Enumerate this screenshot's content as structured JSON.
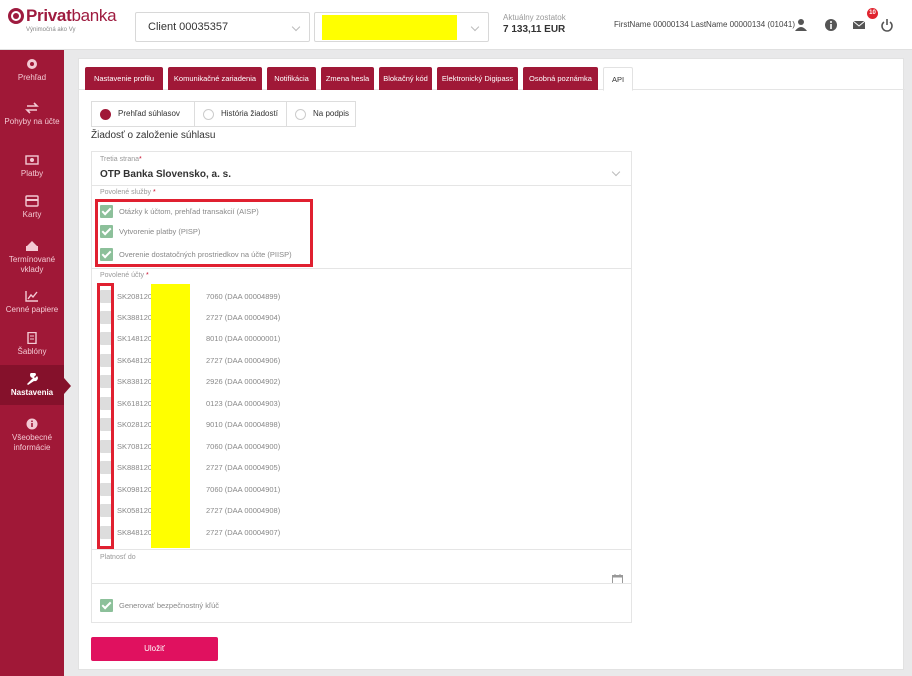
{
  "header": {
    "logo_main": "Privat",
    "logo_light": "banka",
    "logo_sub": "Výnimočná ako Vy",
    "client": "Client 00035357",
    "balance_label": "Aktuálny zostatok",
    "balance_value": "7 133,11 EUR",
    "user_name": "FirstName 00000134 LastName 00000134 (01041)",
    "mail_count": "10"
  },
  "sidebar": {
    "items": [
      {
        "label": "Prehľad",
        "icon": "dashboard-icon"
      },
      {
        "label": "Pohyby na účte",
        "icon": "transfers-icon"
      },
      {
        "label": "Platby",
        "icon": "payments-icon"
      },
      {
        "label": "Karty",
        "icon": "card-icon"
      },
      {
        "label": "Termínované vklady",
        "icon": "deposits-icon"
      },
      {
        "label": "Cenné papiere",
        "icon": "chart-icon"
      },
      {
        "label": "Šablóny",
        "icon": "document-icon"
      },
      {
        "label": "Nastavenia",
        "icon": "wrench-icon"
      },
      {
        "label": "Všeobecné informácie",
        "icon": "info-icon"
      }
    ]
  },
  "tabs": [
    "Nastavenie profilu",
    "Komunikačné zariadenia",
    "Notifikácia",
    "Zmena hesla",
    "Blokačný kód",
    "Elektronický Digipass",
    "Osobná poznámka",
    "API"
  ],
  "subtabs": [
    "Prehľad súhlasov",
    "História žiadostí",
    "Na podpis"
  ],
  "section_title": "Žiadosť o založenie súhlasu",
  "form": {
    "third_party_label": "Tretia strana",
    "third_party_value": "OTP Banka Slovensko, a. s.",
    "services_label": "Povolené služby",
    "services": [
      "Otázky k účtom, prehľad transakcií (AISP)",
      "Vytvorenie platby (PISP)",
      "Overenie dostatočných prostriedkov na účte (PIISP)"
    ],
    "accounts_label": "Povolené účty",
    "accounts": [
      {
        "prefix": "SK208120",
        "suffix": "7060 (DAA 00004899)"
      },
      {
        "prefix": "SK388120",
        "suffix": "2727 (DAA 00004904)"
      },
      {
        "prefix": "SK148120",
        "suffix": "8010 (DAA 00000001)"
      },
      {
        "prefix": "SK648120",
        "suffix": "2727 (DAA 00004906)"
      },
      {
        "prefix": "SK838120",
        "suffix": "2926 (DAA 00004902)"
      },
      {
        "prefix": "SK618120",
        "suffix": "0123 (DAA 00004903)"
      },
      {
        "prefix": "SK028120",
        "suffix": "9010 (DAA 00004898)"
      },
      {
        "prefix": "SK708120",
        "suffix": "7060 (DAA 00004900)"
      },
      {
        "prefix": "SK888120",
        "suffix": "2727 (DAA 00004905)"
      },
      {
        "prefix": "SK098120",
        "suffix": "7060 (DAA 00004901)"
      },
      {
        "prefix": "SK058120",
        "suffix": "2727 (DAA 00004908)"
      },
      {
        "prefix": "SK848120",
        "suffix": "2727 (DAA 00004907)"
      }
    ],
    "validity_label": "Platnosť do",
    "generate_key_label": "Generovať bezpečnostný kľúč"
  },
  "save_label": "Uložiť",
  "colors": {
    "brand": "#a01837",
    "save": "#e0115f",
    "highlight": "#e02030",
    "check": "#8cc09a"
  }
}
